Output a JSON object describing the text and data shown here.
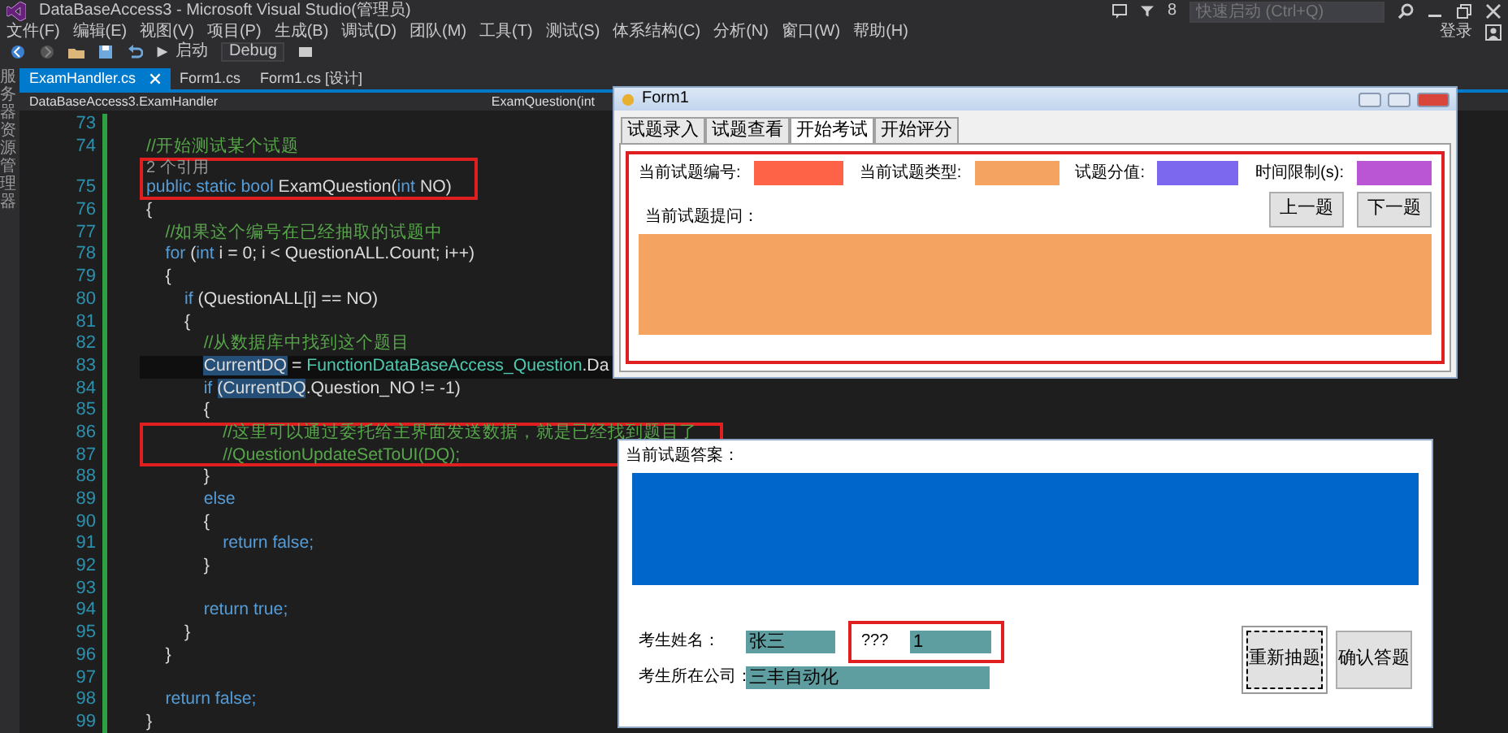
{
  "window": {
    "title": "DataBaseAccess3 - Microsoft Visual Studio(管理员)"
  },
  "notifications": {
    "count": "8"
  },
  "quick_launch": {
    "placeholder": "快速启动 (Ctrl+Q)"
  },
  "sign_in": "登录",
  "menu": [
    "文件(F)",
    "编辑(E)",
    "视图(V)",
    "项目(P)",
    "生成(B)",
    "调试(D)",
    "团队(M)",
    "工具(T)",
    "测试(S)",
    "体系结构(C)",
    "分析(N)",
    "窗口(W)",
    "帮助(H)"
  ],
  "toolbar": {
    "start": "启动",
    "configuration": "Debug"
  },
  "side_panel": "服务器资源管理器",
  "document_tabs": [
    {
      "label": "ExamHandler.cs",
      "selected": true
    },
    {
      "label": "Form1.cs",
      "selected": false
    },
    {
      "label": "Form1.cs [设计]",
      "selected": false
    }
  ],
  "navigation": {
    "scope": "DataBaseAccess3.ExamHandler",
    "member": "ExamQuestion(int"
  },
  "editor": {
    "lines": [
      {
        "number": "73",
        "current": false,
        "boxed": false
      },
      {
        "number": "74",
        "current": false,
        "boxed": false,
        "tokens": [
          {
            "text": "//开始测试某个试题",
            "kind": "comment"
          }
        ]
      },
      {
        "number": "75",
        "current": false,
        "boxed": true,
        "codelens": "2 个引用",
        "tokens": [
          {
            "text": "public static bool",
            "kind": "keyword"
          },
          {
            "text": " ExamQuestion(",
            "kind": "plain"
          },
          {
            "text": "int",
            "kind": "keyword"
          },
          {
            "text": " NO)",
            "kind": "plain"
          }
        ]
      },
      {
        "number": "76",
        "current": false,
        "boxed": false,
        "tokens": [
          {
            "text": "{",
            "kind": "plain"
          }
        ]
      },
      {
        "number": "77",
        "current": false,
        "boxed": false,
        "tokens": [
          {
            "text": "    //如果这个编号在已经抽取的试题中",
            "kind": "comment"
          }
        ]
      },
      {
        "number": "78",
        "current": false,
        "boxed": false,
        "tokens": [
          {
            "text": "    for",
            "kind": "keyword"
          },
          {
            "text": " (",
            "kind": "plain"
          },
          {
            "text": "int",
            "kind": "keyword"
          },
          {
            "text": " i = 0; i < QuestionALL.Count; i++)",
            "kind": "plain"
          }
        ]
      },
      {
        "number": "79",
        "current": false,
        "boxed": false,
        "tokens": [
          {
            "text": "    {",
            "kind": "plain"
          }
        ]
      },
      {
        "number": "80",
        "current": false,
        "boxed": false,
        "tokens": [
          {
            "text": "        if",
            "kind": "keyword"
          },
          {
            "text": " (QuestionALL[i] == NO)",
            "kind": "plain"
          }
        ]
      },
      {
        "number": "81",
        "current": false,
        "boxed": false,
        "tokens": [
          {
            "text": "        {",
            "kind": "plain"
          }
        ]
      },
      {
        "number": "82",
        "current": false,
        "boxed": false,
        "tokens": [
          {
            "text": "            //从数据库中找到这个题目",
            "kind": "comment"
          }
        ]
      },
      {
        "number": "83",
        "current": true,
        "boxed": false,
        "tokens": [
          {
            "text": "            CurrentDQ",
            "kind": "selection"
          },
          {
            "text": " = ",
            "kind": "plain"
          },
          {
            "text": "FunctionDataBaseAccess_Question",
            "kind": "type"
          },
          {
            "text": ".Da",
            "kind": "plain"
          }
        ]
      },
      {
        "number": "84",
        "current": false,
        "boxed": false,
        "tokens": [
          {
            "text": "            if ",
            "kind": "keyword"
          },
          {
            "text": "(CurrentDQ",
            "kind": "selection"
          },
          {
            "text": ".Question_NO != -1)",
            "kind": "plain"
          }
        ]
      },
      {
        "number": "85",
        "current": false,
        "boxed": false,
        "tokens": [
          {
            "text": "            {",
            "kind": "plain"
          }
        ]
      },
      {
        "number": "86",
        "current": false,
        "boxed": true,
        "tokens": [
          {
            "text": "                //这里可以通过委托给主界面发送数据，就是已经找到题目了",
            "kind": "comment"
          }
        ]
      },
      {
        "number": "87",
        "current": false,
        "boxed": true,
        "tokens": [
          {
            "text": "                //QuestionUpdateSetToUI(DQ);",
            "kind": "comment"
          }
        ]
      },
      {
        "number": "88",
        "current": false,
        "boxed": false,
        "tokens": [
          {
            "text": "            }",
            "kind": "plain"
          }
        ]
      },
      {
        "number": "89",
        "current": false,
        "boxed": false,
        "tokens": [
          {
            "text": "            else",
            "kind": "keyword"
          }
        ]
      },
      {
        "number": "90",
        "current": false,
        "boxed": false,
        "tokens": [
          {
            "text": "            {",
            "kind": "plain"
          }
        ]
      },
      {
        "number": "91",
        "current": false,
        "boxed": false,
        "tokens": [
          {
            "text": "                return false;",
            "kind": "keyword"
          }
        ]
      },
      {
        "number": "92",
        "current": false,
        "boxed": false,
        "tokens": [
          {
            "text": "            }",
            "kind": "plain"
          }
        ]
      },
      {
        "number": "93",
        "current": false,
        "boxed": false
      },
      {
        "number": "94",
        "current": false,
        "boxed": false,
        "tokens": [
          {
            "text": "            return true;",
            "kind": "keyword"
          }
        ]
      },
      {
        "number": "95",
        "current": false,
        "boxed": false,
        "tokens": [
          {
            "text": "        }",
            "kind": "plain"
          }
        ]
      },
      {
        "number": "96",
        "current": false,
        "boxed": false,
        "tokens": [
          {
            "text": "    }",
            "kind": "plain"
          }
        ]
      },
      {
        "number": "97",
        "current": false,
        "boxed": false
      },
      {
        "number": "98",
        "current": false,
        "boxed": false,
        "tokens": [
          {
            "text": "    return false;",
            "kind": "keyword"
          }
        ]
      },
      {
        "number": "99",
        "current": false,
        "boxed": false,
        "tokens": [
          {
            "text": "}",
            "kind": "plain"
          }
        ]
      }
    ]
  },
  "form": {
    "title": "Form1",
    "boxed": true,
    "tabs": [
      {
        "label": "试题录入",
        "selected": false
      },
      {
        "label": "试题查看",
        "selected": false
      },
      {
        "label": "开始考试",
        "selected": true
      },
      {
        "label": "开始评分",
        "selected": false
      }
    ],
    "question_info": [
      {
        "label": "当前试题编号:",
        "color": "#ff6347"
      },
      {
        "label": "当前试题类型:",
        "color": "#f4a460"
      },
      {
        "label": "试题分值:",
        "color": "#7b68ee"
      },
      {
        "label": "时间限制(s):",
        "color": "#ba55d3"
      }
    ],
    "nav_buttons": [
      "上一题",
      "下一题"
    ],
    "question_label": "当前试题提问："
  },
  "answer_panel": {
    "label": "当前试题答案：",
    "fields": [
      {
        "label": "考生姓名：",
        "value": "张三",
        "boxed": false
      },
      {
        "label": "???",
        "value": "1",
        "boxed": true
      },
      {
        "label": "考生所在公司：",
        "value": "三丰自动化",
        "boxed": false
      }
    ],
    "buttons": [
      {
        "label": "重新抽题",
        "selected": true
      },
      {
        "label": "确认答题",
        "selected": false
      }
    ]
  }
}
